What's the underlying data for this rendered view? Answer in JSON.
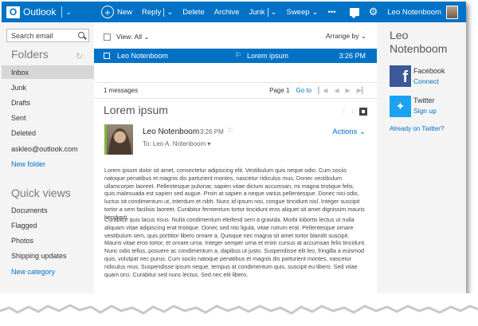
{
  "app": {
    "name": "Outlook"
  },
  "toolbar": {
    "new_label": "New",
    "reply_label": "Reply",
    "delete_label": "Delete",
    "archive_label": "Archive",
    "junk_label": "Junk",
    "sweep_label": "Sweep",
    "more_label": "•••",
    "user_name": "Leo Notenboom"
  },
  "sidebar": {
    "search_placeholder": "Search email",
    "folders_heading": "Folders",
    "folders": [
      {
        "label": "Inbox",
        "selected": true
      },
      {
        "label": "Junk"
      },
      {
        "label": "Drafts"
      },
      {
        "label": "Sent"
      },
      {
        "label": "Deleted"
      },
      {
        "label": "askleo@outlook.com"
      }
    ],
    "new_folder_label": "New folder",
    "quick_views_heading": "Quick views",
    "quick_views": [
      {
        "label": "Documents"
      },
      {
        "label": "Flagged"
      },
      {
        "label": "Photos"
      },
      {
        "label": "Shipping updates"
      }
    ],
    "new_category_label": "New category"
  },
  "list": {
    "view_label": "View: All",
    "arrange_label": "Arrange by",
    "selected_message": {
      "sender": "Leo Notenboom",
      "subject": "Lorem ipsum",
      "time": "3:26 PM"
    },
    "count_label": "1 messages",
    "page_label": "Page 1",
    "goto_label": "Go to"
  },
  "reading": {
    "subject": "Lorem ipsum",
    "sender": "Leo Notenboom",
    "time": "3:26 PM",
    "to_line": "To: Leo A. Notenboom",
    "actions_label": "Actions",
    "paragraphs": [
      "Lorem ipsum dolor sit amet, consectetur adipiscing elit. Vestibulum quis neque odio. Cum sociis natoque penatibus et magnis dis parturient montes, nascetur ridiculus mus. Donec vestibulum ullamcorper laoreet. Pellentesque pulvinar, sapien vitae dictum accumsan, mi magna tristique felis, quis malesuada est sapien sed augue. Proin at sapien a neque varius pellentesque. Donec nisi odio, luctus sit condimentum ut, interdum et nibh. Nunc id ipsum nisi, congue tincidunt nisl. Integer suscipit tortor a sem facilisis laoreet. Curabitur fermentum tortor tincidunt eros aliquet sit amet dignissim mauris hendrerit.",
      "Curabitur quis lacus risus. Nulla condimentum eleifend sem a gravida. Morbi lobortis lectus ut nulla aliquam vitae adipiscing erat tristique. Donec sed nisi ligula, vitae rutrum erat. Pellentesque ornare vestibulum sem, quis porttitor libero ornare a. Quisque nec magna sit amet tortor blandit suscipit. Mauris vitae eros tortor, et ornare urna. Integer semper urna et enim cursus at accumsan felis tincidunt. Nunc odio tellus, posuere ac condimentum a, dapibus ut justo. Suspendisse elit leo, fringilla a euismod quis, volutpat nec purus. Cum sociis natoque penatibus et magnis dis parturient montes, nascetur ridiculus mus. Suspendisse ipsum neque, tempus at condimentum quis, suscipit eu libero. Sed vitae quam orci. Curabitur sed nunc lectus. Sed nec elit libero."
    ]
  },
  "contact": {
    "name": "Leo Notenboom",
    "facebook_label": "Facebook",
    "facebook_link": "Connect",
    "twitter_label": "Twitter",
    "twitter_link": "Sign up",
    "twitter_prompt": "Already on Twitter?"
  }
}
